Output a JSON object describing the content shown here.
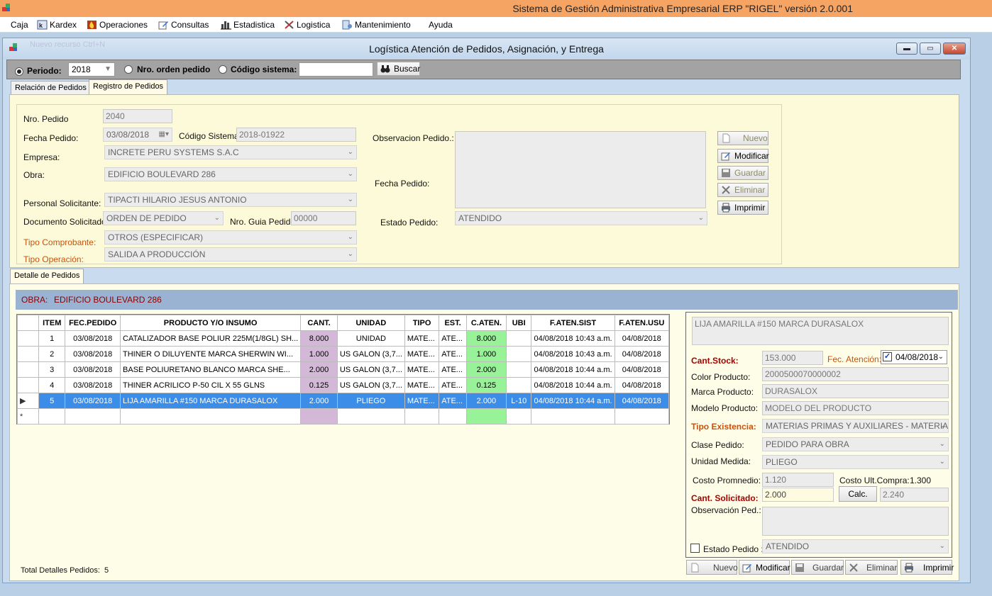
{
  "app": {
    "title": "Sistema de Gestión Administrativa Empresarial ERP  \"RIGEL\" versión 2.0.001"
  },
  "menu": [
    {
      "label": "Caja",
      "icon": "none"
    },
    {
      "label": "Kardex",
      "icon": "kardex-icon"
    },
    {
      "label": "Operaciones",
      "icon": "fire-icon"
    },
    {
      "label": "Consultas",
      "icon": "edit-icon"
    },
    {
      "label": "Estadistica",
      "icon": "chart-icon"
    },
    {
      "label": "Logistica",
      "icon": "tools-icon"
    },
    {
      "label": "Mantenimiento",
      "icon": "maintenance-icon"
    },
    {
      "label": "Ayuda",
      "icon": "none"
    }
  ],
  "window": {
    "title": "Logística  Atención de Pedidos, Asignación, y Entrega",
    "ghost": "Nuevo recurso          Ctrl+N"
  },
  "search": {
    "periodo_label": "Periodo:",
    "periodo_value": "2018",
    "orden_label": "Nro. orden pedido",
    "codigo_label": "Código sistema:",
    "codigo_value": "",
    "buscar_label": "Buscar"
  },
  "tabs": {
    "relacion": "Relación de Pedidos",
    "registro": "Registro de Pedidos",
    "detalle": "Detalle de Pedidos"
  },
  "form": {
    "nro_pedido_label": "Nro. Pedido",
    "nro_pedido_value": "2040",
    "fecha_label": "Fecha Pedido:",
    "fecha_value": "03/08/2018",
    "codigo_sistema_label": "Código Sistema:",
    "codigo_sistema_value": "2018-01922",
    "empresa_label": "Empresa:",
    "empresa_value": "INCRETE PERU SYSTEMS S.A.C",
    "obra_label": "Obra:",
    "obra_value": "EDIFICIO BOULEVARD 286",
    "personal_label": "Personal Solicitante:",
    "personal_value": "TIPACTI HILARIO JESUS ANTONIO",
    "documento_label": "Documento Solicitado:",
    "documento_value": "ORDEN DE PEDIDO",
    "guia_label": "Nro. Guia Pedido:",
    "guia_value": "00000",
    "comprobante_label": "Tipo Comprobante:",
    "comprobante_value": "OTROS (ESPECIFICAR)",
    "operacion_label": "Tipo Operación:",
    "operacion_value": "SALIDA A PRODUCCIÓN",
    "observacion_label": "Observacion Pedido.:",
    "observacion_value": "",
    "fecha_pedido2_label": "Fecha Pedido:",
    "estado_label": "Estado Pedido:",
    "estado_value": "ATENDIDO"
  },
  "form_buttons": {
    "nuevo": "Nuevo",
    "modificar": "Modificar",
    "guardar": "Guardar",
    "eliminar": "Eliminar",
    "imprimir": "Imprimir"
  },
  "obra_bar": {
    "label": "OBRA:",
    "value": "EDIFICIO BOULEVARD 286"
  },
  "grid": {
    "headers": [
      "ITEM",
      "FEC.PEDIDO",
      "PRODUCTO Y/O INSUMO",
      "CANT.",
      "UNIDAD",
      "TIPO",
      "EST.",
      "C.ATEN.",
      "UBI",
      "F.ATEN.SIST",
      "F.ATEN.USU"
    ],
    "rows": [
      {
        "item": "1",
        "fec": "03/08/2018",
        "producto": "CATALIZADOR BASE POLIUR 225M(1/8GL) SH...",
        "cant": "8.000",
        "unidad": "UNIDAD",
        "tipo": "MATE...",
        "est": "ATE...",
        "caten": "8.000",
        "ubi": "",
        "fsist": "04/08/2018 10:43 a.m.",
        "fusu": "04/08/2018"
      },
      {
        "item": "2",
        "fec": "03/08/2018",
        "producto": "THINER O DILUYENTE MARCA SHERWIN WI...",
        "cant": "1.000",
        "unidad": "US GALON (3,7...",
        "tipo": "MATE...",
        "est": "ATE...",
        "caten": "1.000",
        "ubi": "",
        "fsist": "04/08/2018 10:43 a.m.",
        "fusu": "04/08/2018"
      },
      {
        "item": "3",
        "fec": "03/08/2018",
        "producto": "BASE POLIURETANO BLANCO MARCA SHE...",
        "cant": "2.000",
        "unidad": "US GALON (3,7...",
        "tipo": "MATE...",
        "est": "ATE...",
        "caten": "2.000",
        "ubi": "",
        "fsist": "04/08/2018 10:44 a.m.",
        "fusu": "04/08/2018"
      },
      {
        "item": "4",
        "fec": "03/08/2018",
        "producto": "THINER ACRILICO P-50 CIL X 55 GLNS",
        "cant": "0.125",
        "unidad": "US GALON (3,7...",
        "tipo": "MATE...",
        "est": "ATE...",
        "caten": "0.125",
        "ubi": "",
        "fsist": "04/08/2018 10:44 a.m.",
        "fusu": "04/08/2018"
      },
      {
        "item": "5",
        "fec": "03/08/2018",
        "producto": "LIJA AMARILLA #150 MARCA DURASALOX",
        "cant": "2.000",
        "unidad": "PLIEGO",
        "tipo": "MATE...",
        "est": "ATE...",
        "caten": "2.000",
        "ubi": "L-10",
        "fsist": "04/08/2018 10:44 a.m.",
        "fusu": "04/08/2018"
      }
    ],
    "selected_row": 5,
    "new_row_marker": "*",
    "current_row_marker": "▶"
  },
  "detail": {
    "producto": "LIJA AMARILLA #150 MARCA DURASALOX",
    "stock_label": "Cant.Stock:",
    "stock_value": "153.000",
    "fec_atencion_label": "Fec. Atención:",
    "fec_atencion_value": "04/08/2018",
    "fec_atencion_checked": true,
    "color_label": "Color Producto:",
    "color_value": "2000500070000002",
    "marca_label": "Marca Producto:",
    "marca_value": "DURASALOX",
    "modelo_label": "Modelo Producto:",
    "modelo_value": "MODELO DEL PRODUCTO",
    "existencia_label": "Tipo Existencia:",
    "existencia_value": "MATERIAS PRIMAS Y AUXILIARES - MATERIAL",
    "clase_label": "Clase Pedido:",
    "clase_value": "PEDIDO PARA OBRA",
    "unidad_label": "Unidad Medida:",
    "unidad_value": "PLIEGO",
    "costo_prom_label": "Costo Promnedio:",
    "costo_prom_value": "1.120",
    "costo_ult_label": "Costo Ult.Compra:",
    "costo_ult_value": "1.300",
    "solicitado_label": "Cant. Solicitado:",
    "solicitado_value": "2.000",
    "calc_label": "Calc.",
    "calc_value": "2.240",
    "observacion_label": "Observación Ped.:",
    "observacion_value": "",
    "estado_label": "Estado Pedido :",
    "estado_value": "ATENDIDO",
    "estado_checked": false
  },
  "detail_buttons": {
    "nuevo": "Nuevo",
    "modificar": "Modificar",
    "guardar": "Guardar",
    "eliminar": "Eliminar",
    "imprimir": "Imprimir"
  },
  "footer": {
    "total_label": "Total Detalles Pedidos:",
    "total_value": "5"
  }
}
